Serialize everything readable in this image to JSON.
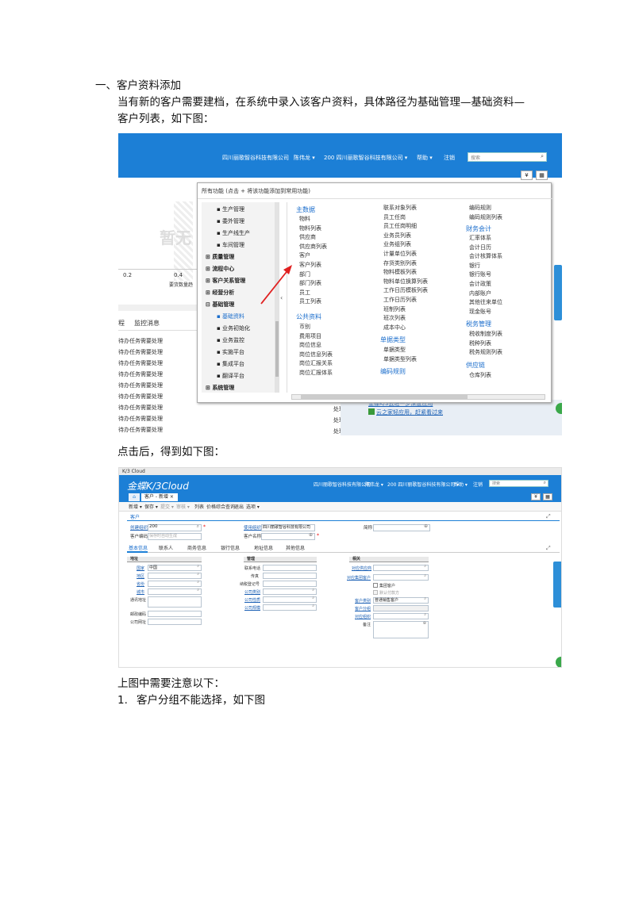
{
  "doc": {
    "heading": "一、客户资料添加",
    "para1_line1": "当有新的客户需要建档，在系统中录入该客户资料，具体路径为基础管理—基础资料—",
    "para1_line2": "客户列表，如下图：",
    "para2": "点击后，得到如下图：",
    "para3": "上图中需要注意以下：",
    "list1_num": "1.",
    "list1_text": "客户分组不能选择，如下图"
  },
  "shot1": {
    "company": "四川丽歌智谷科技有限公司",
    "user": "陈伟龙 ▾",
    "org": "200  四川丽歌智谷科技有限公司 ▾",
    "help": "帮助 ▾",
    "logout": "注销",
    "search_placeholder": "搜索",
    "menu_header": "所有功能  (点击 + 将该功能添加到常用功能)",
    "chart_ticks": [
      "0.2",
      "0.4"
    ],
    "chart_label": "要货数量趋",
    "chart_watermark": "暂无",
    "tabs": [
      "程",
      "监控消息"
    ],
    "tasks": [
      "待办任务需要处理",
      "待办任务需要处理",
      "待办任务需要处理",
      "待办任务需要处理",
      "待办任务需要处理",
      "待办任务需要处理",
      "待办任务需要处理",
      "待办任务需要处理",
      "待办任务需要处理"
    ],
    "task_status": [
      "处理",
      "处理",
      "处理"
    ],
    "tree": [
      {
        "label": "生产管理",
        "bold": false
      },
      {
        "label": "委外管理",
        "bold": false
      },
      {
        "label": "生产线生产",
        "bold": false
      },
      {
        "label": "车间管理",
        "bold": false
      },
      {
        "label": "质量管理",
        "bold": true
      },
      {
        "label": "流程中心",
        "bold": true
      },
      {
        "label": "客户关系管理",
        "bold": true
      },
      {
        "label": "经营分析",
        "bold": true
      },
      {
        "label": "基础管理",
        "bold": true
      },
      {
        "label": "基础资料",
        "bold": false
      },
      {
        "label": "业务初始化",
        "bold": false
      },
      {
        "label": "业务监控",
        "bold": false
      },
      {
        "label": "实施平台",
        "bold": false
      },
      {
        "label": "集成平台",
        "bold": false
      },
      {
        "label": "翻译平台",
        "bold": false
      },
      {
        "label": "系统管理",
        "bold": true
      }
    ],
    "col1_title": "主数据",
    "col1_items": [
      "物料",
      "物料列表",
      "供应商",
      "供应商列表",
      "客户",
      "客户列表",
      "部门",
      "部门列表",
      "员工",
      "员工列表"
    ],
    "col1_title2": "公共资料",
    "col1_items2": [
      "币别",
      "费用项目",
      "岗位信息",
      "岗位信息列表",
      "岗位汇报关系",
      "岗位汇报体系"
    ],
    "col2_items": [
      "联系对象列表",
      "员工任岗",
      "员工任岗明细",
      "业务员列表",
      "业务组列表",
      "计量单位列表",
      "存货类别列表",
      "物料模板列表",
      "物料单位换算列表",
      "工作日历模板列表",
      "工作日历列表",
      "班制列表",
      "班次列表",
      "成本中心"
    ],
    "col2_title": "单据类型",
    "col2_items2": [
      "单据类型",
      "单据类型列表"
    ],
    "col2_title2": "编码规则",
    "col3_items": [
      "编码规则",
      "编码规则列表"
    ],
    "col3_title": "财务会计",
    "col3_items2": [
      "汇率体系",
      "会计日历",
      "会计核算体系",
      "银行",
      "银行账号",
      "会计政策",
      "内部账户",
      "其他往来单位",
      "现金账号"
    ],
    "col3_title2": "税务管理",
    "col3_items3": [
      "税收制度列表",
      "税种列表",
      "税务规则列表"
    ],
    "col3_title3": "供应链",
    "col3_items4": [
      "仓库列表"
    ],
    "bottom_links": [
      "金蝶K/3云进一步深度应用",
      "云之家轻应用，赶紧看过来"
    ]
  },
  "shot2": {
    "titlebar": "K/3 Cloud",
    "logo": "金蝶K/3Cloud",
    "company": "四川丽歌智谷科技有限公司",
    "user": "陈伟龙 ▾",
    "org": "200  四川丽歌智谷科技有限公司 ▾",
    "help": "帮助 ▾",
    "logout": "注销",
    "search_placeholder": "搜索",
    "tab_label": "客户 - 新增 ×",
    "toolbar": [
      "新增 ▾",
      "保存 ▾",
      "提交 ▾",
      "审核 ▾",
      "列表",
      "价格综合查询",
      "退出",
      "选项 ▾"
    ],
    "section": "客户",
    "create_org_label": "创建组织",
    "create_org_value": "200",
    "cust_code_label": "客户编码",
    "cust_code_placeholder": "保存时自动生成",
    "use_org_label": "使用组织",
    "use_org_value": "四川丽歌智谷科技有限公司",
    "cust_name_label": "客户名称",
    "short_name_label": "简称",
    "subtabs": [
      "基本信息",
      "联系人",
      "商务信息",
      "银行信息",
      "地址信息",
      "其他信息"
    ],
    "grp1_title": "地址",
    "grp1_fields": [
      "国家",
      "地区",
      "省份",
      "城市",
      "通讯地址",
      "邮政编码",
      "公司网址"
    ],
    "country_value": "中国",
    "grp2_title": "管理",
    "grp2_fields": [
      "联系电话",
      "传真",
      "纳税登记号",
      "公司类别",
      "公司性质",
      "公司规模"
    ],
    "grp3_title": "相关",
    "grp3_fields": [
      "对应供应商",
      "对应集团客户",
      "客户类别",
      "客户分组",
      "对应组织",
      "备注"
    ],
    "group_cust": "集团客户",
    "default_pay": "默认付款方",
    "cust_type_value": "普通销售客户"
  }
}
